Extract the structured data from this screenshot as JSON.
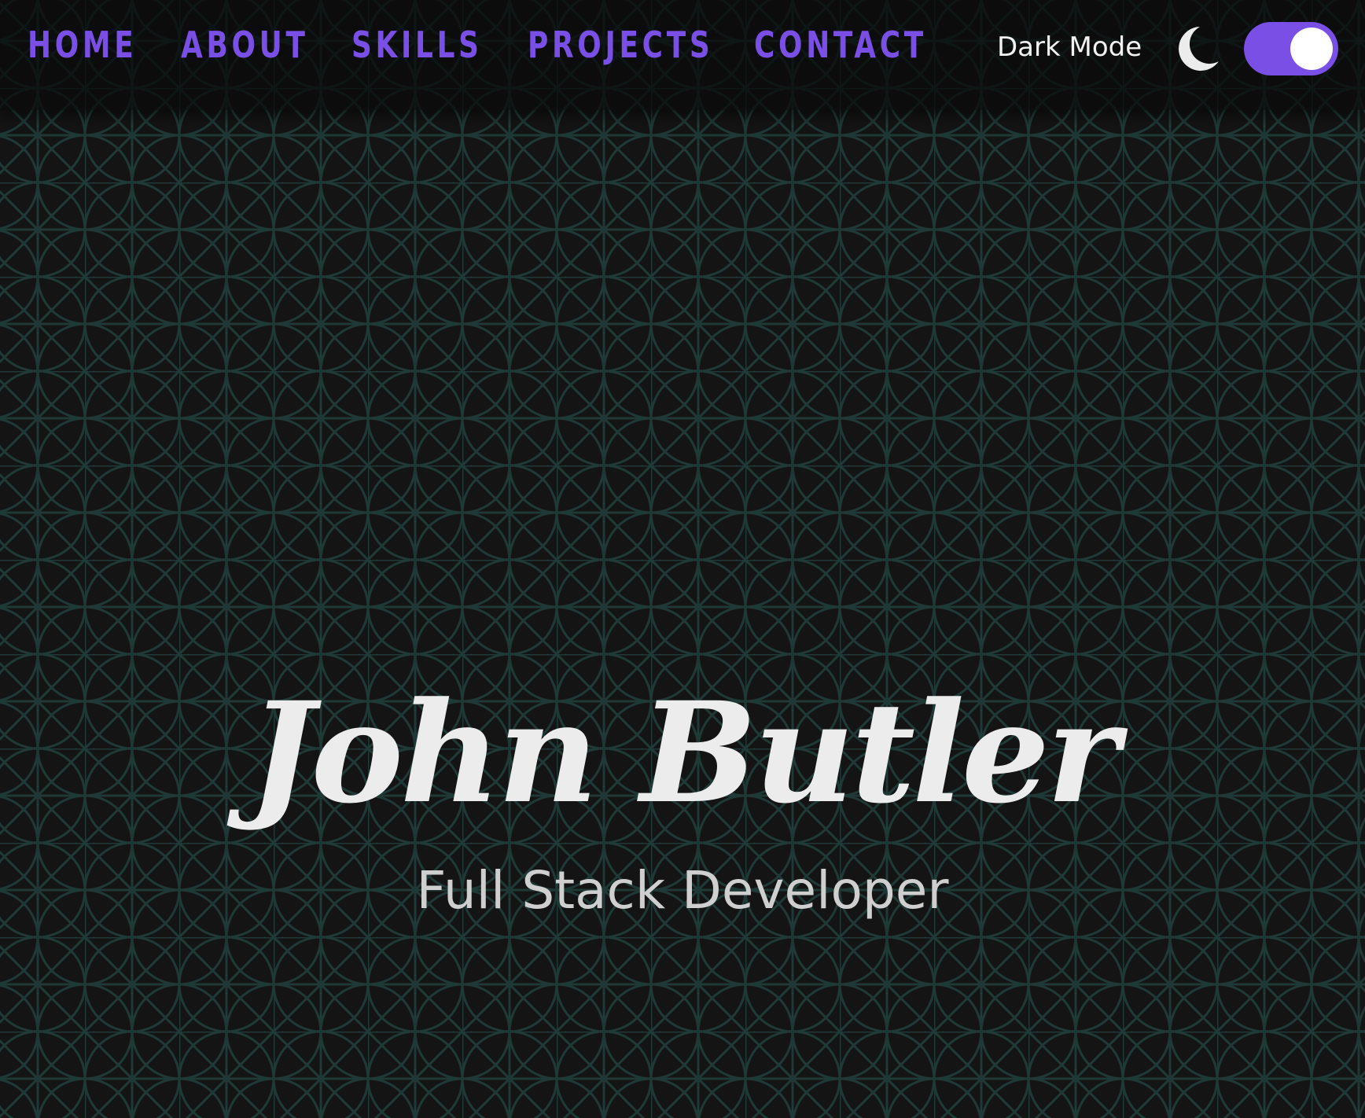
{
  "nav": {
    "items": [
      {
        "label": "HOME"
      },
      {
        "label": "ABOUT"
      },
      {
        "label": "SKILLS"
      },
      {
        "label": "PROJECTS"
      },
      {
        "label": "CONTACT"
      }
    ]
  },
  "theme": {
    "mode_label": "Dark Mode",
    "toggle_on": true,
    "moon_icon": "moon-icon"
  },
  "hero": {
    "name": "John Butler",
    "subtitle": "Full Stack Developer"
  },
  "colors": {
    "accent": "#7a4fe6",
    "background": "#141414",
    "pattern": "#1f3a36",
    "text": "#ececec"
  }
}
